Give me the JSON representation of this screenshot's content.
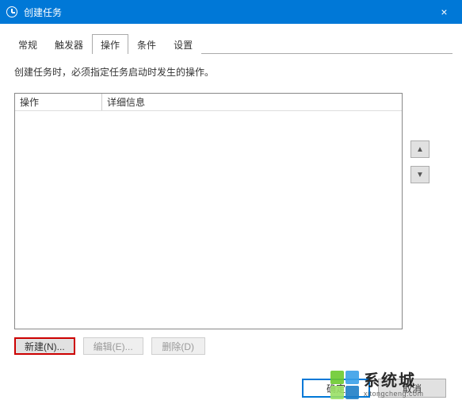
{
  "window": {
    "title": "创建任务",
    "close": "×"
  },
  "tabs": {
    "items": [
      {
        "label": "常规"
      },
      {
        "label": "触发器"
      },
      {
        "label": "操作"
      },
      {
        "label": "条件"
      },
      {
        "label": "设置"
      }
    ],
    "active_index": 2
  },
  "description": "创建任务时，必须指定任务启动时发生的操作。",
  "list": {
    "columns": {
      "col1": "操作",
      "col2": "详细信息"
    },
    "rows": []
  },
  "side": {
    "up": "▲",
    "down": "▼"
  },
  "buttons": {
    "new": "新建(N)...",
    "edit": "编辑(E)...",
    "delete": "删除(D)"
  },
  "footer": {
    "ok": "确定",
    "cancel": "取消"
  },
  "watermark": {
    "name": "系统城",
    "url": "xitongcheng.com"
  }
}
